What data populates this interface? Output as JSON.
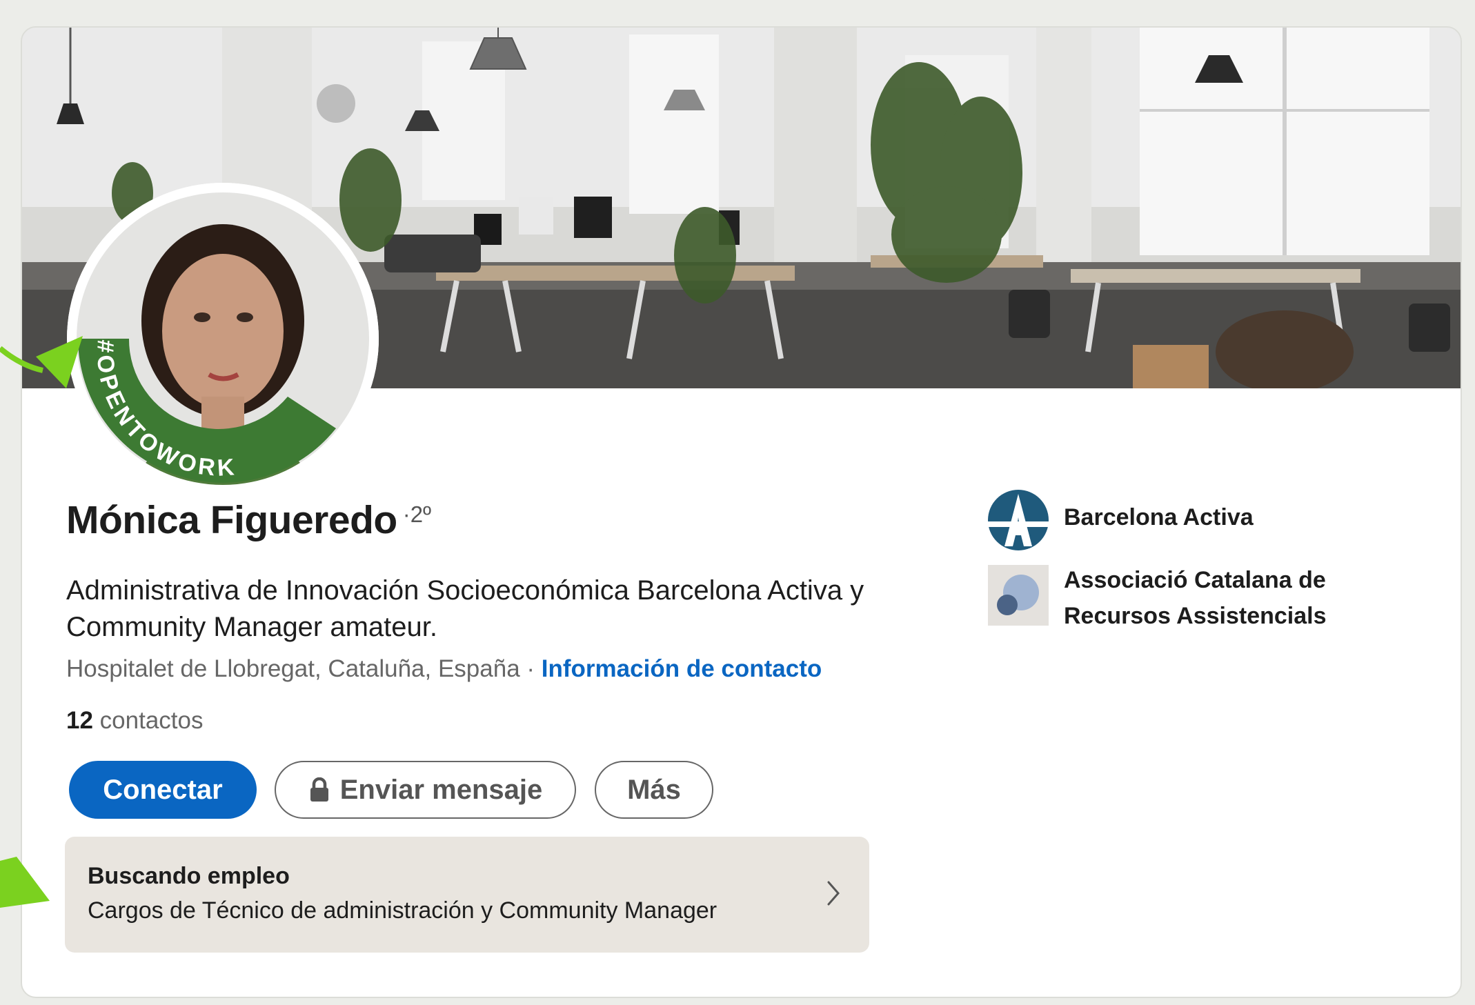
{
  "profile": {
    "name": "Mónica Figueredo",
    "degree": "·2º",
    "headline": "Administrativa de Innovación Socioeconómica Barcelona Activa y Community Manager amateur.",
    "location": "Hospitalet de Llobregat, Cataluña, España ·",
    "contact_link": "Información de contacto",
    "connections_count": "12",
    "connections_label": "contactos",
    "open_to_work_frame": "#OPENTOWORK"
  },
  "actions": {
    "connect": "Conectar",
    "message": "Enviar mensaje",
    "more": "Más"
  },
  "open_to_work": {
    "title": "Buscando empleo",
    "roles": "Cargos de Técnico de administración y Community Manager"
  },
  "companies": [
    {
      "name": "Barcelona Activa",
      "icon": "barcelona-activa-logo"
    },
    {
      "name": "Associació Catalana de Recursos Assistencials",
      "icon": "associacio-catalana-logo"
    }
  ],
  "colors": {
    "accent": "#0a66c2",
    "open_to_work_green": "#3d7a33",
    "annotation_green": "#7bd11f"
  }
}
